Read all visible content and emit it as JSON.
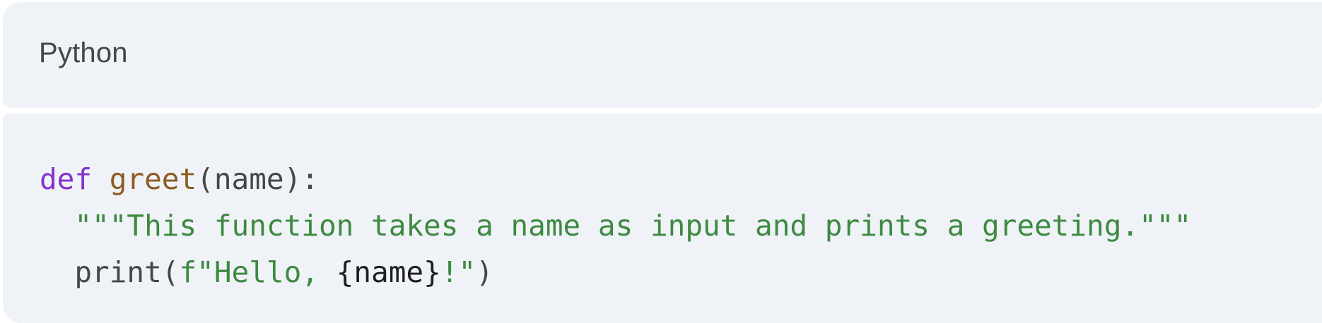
{
  "code_block": {
    "language": "Python",
    "lines": [
      {
        "tokens": {
          "t0": "def",
          "t1": " ",
          "t2": "greet",
          "t3": "(",
          "t4": "name",
          "t5": "):"
        }
      },
      {
        "tokens": {
          "t0": "  ",
          "t1": "\"\"\"This function takes a name as input and prints a greeting.\"\"\""
        }
      },
      {
        "tokens": {
          "t0": "  ",
          "t1": "print",
          "t2": "(",
          "t3": "f\"Hello, ",
          "t4": "{name}",
          "t5": "!\"",
          "t6": ")"
        }
      }
    ]
  },
  "colors": {
    "background": "#eff2f7",
    "keyword": "#8430ce",
    "function_name": "#8d5b23",
    "string": "#3d8a40",
    "plain_text": "#444746",
    "interpolation": "#1f1f1f"
  }
}
